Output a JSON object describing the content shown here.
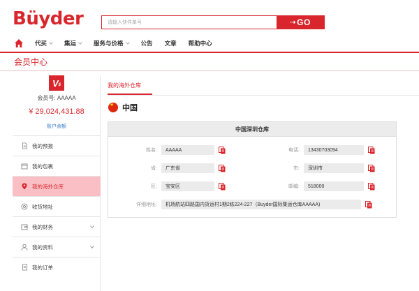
{
  "header": {
    "logo": "Büyder",
    "search_placeholder": "请输入快件单号",
    "search_button": "GO"
  },
  "nav": {
    "items": [
      {
        "label": "代买",
        "dropdown": true
      },
      {
        "label": "集运",
        "dropdown": true
      },
      {
        "label": "服务与价格",
        "dropdown": true
      },
      {
        "label": "公告",
        "dropdown": false
      },
      {
        "label": "文章",
        "dropdown": false
      },
      {
        "label": "帮助中心",
        "dropdown": false
      }
    ]
  },
  "page": {
    "title": "会员中心"
  },
  "sidebar": {
    "member_id": "会员号: AAAAA",
    "balance": "¥ 29,024,431.88",
    "balance_link": "账户余额",
    "menu": [
      {
        "label": "我的预报",
        "icon": "document-icon",
        "active": false,
        "dropdown": false
      },
      {
        "label": "我的包裹",
        "icon": "package-icon",
        "active": false,
        "dropdown": false
      },
      {
        "label": "我的海外仓库",
        "icon": "location-pin-icon",
        "active": true,
        "dropdown": false
      },
      {
        "label": "收货地址",
        "icon": "target-icon",
        "active": false,
        "dropdown": false
      },
      {
        "label": "我的财务",
        "icon": "wallet-icon",
        "active": false,
        "dropdown": true
      },
      {
        "label": "我的资料",
        "icon": "user-icon",
        "active": false,
        "dropdown": true
      },
      {
        "label": "我的订单",
        "icon": "order-icon",
        "active": false,
        "dropdown": false
      }
    ]
  },
  "main": {
    "tab": "我的海外仓库",
    "country": "中国",
    "warehouse": {
      "title": "中国深圳仓库",
      "name_label": "姓名:",
      "name": "AAAAA",
      "phone_label": "电话:",
      "phone": "13430703094",
      "province_label": "省:",
      "province": "广东省",
      "city_label": "市:",
      "city": "深圳市",
      "district_label": "区:",
      "district": "宝安区",
      "zip_label": "邮编:",
      "zip": "518000",
      "address_label": "详细地址:",
      "address": "机场航站四路国内货运村1期2栋224-227（Buyder国际集运仓库AAAAA)"
    }
  },
  "colors": {
    "brand": "#d9262c",
    "active_bg": "#f9bfc4",
    "link": "#3a7bc8"
  }
}
